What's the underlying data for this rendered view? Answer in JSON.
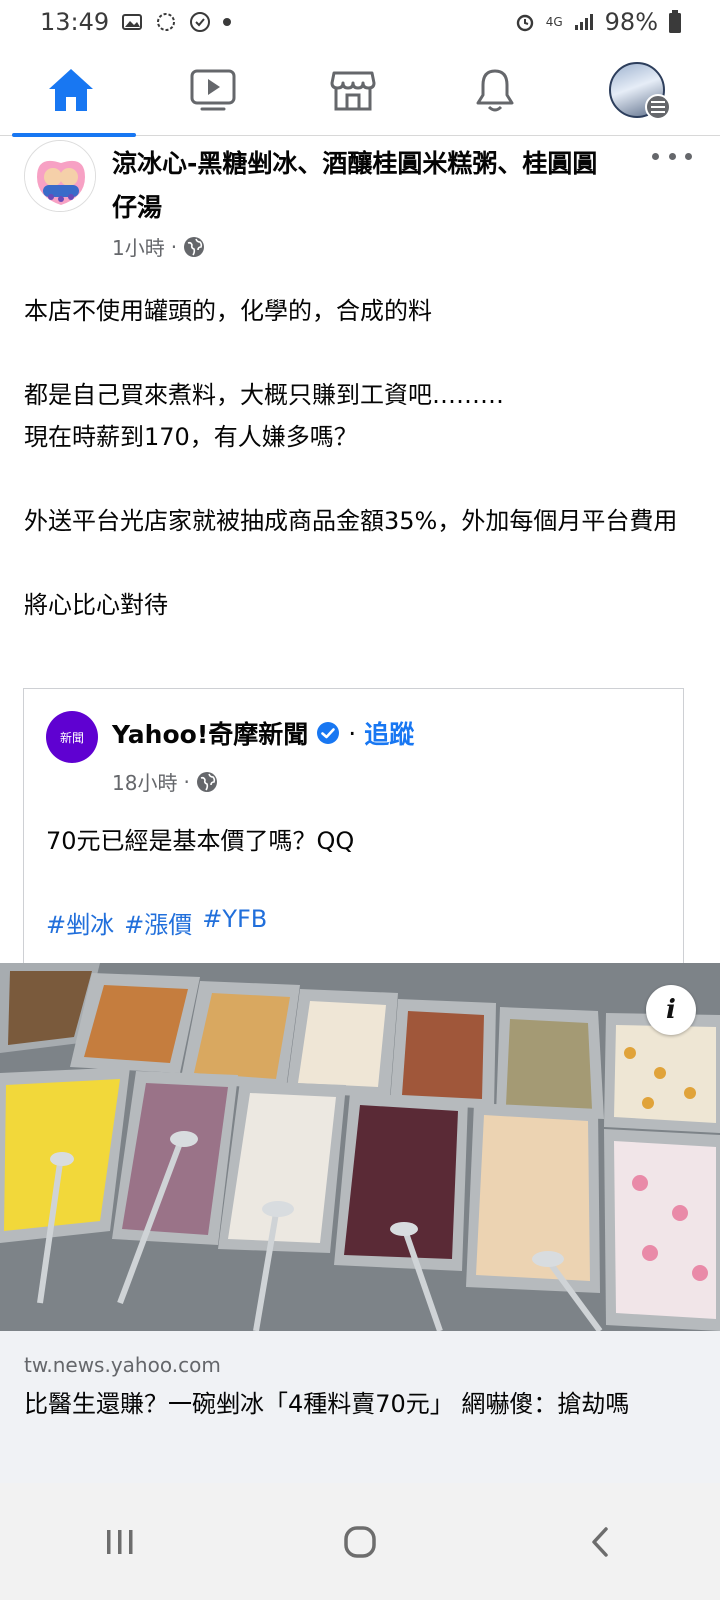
{
  "status_bar": {
    "time": "13:49",
    "network": "4G",
    "battery": "98%"
  },
  "nav": {
    "tabs": [
      {
        "name": "home",
        "icon": "home-icon",
        "active": true
      },
      {
        "name": "watch",
        "icon": "video-icon",
        "active": false
      },
      {
        "name": "marketplace",
        "icon": "marketplace-icon",
        "active": false
      },
      {
        "name": "notifications",
        "icon": "bell-icon",
        "active": false
      },
      {
        "name": "menu",
        "icon": "profile-avatar",
        "active": false
      }
    ],
    "accent_color": "#1877f2"
  },
  "post": {
    "page_name": "涼冰心-黑糖剉冰、酒釀桂圓米糕粥、桂圓圓仔湯",
    "time": "1小時",
    "separator": "·",
    "privacy_icon": "globe-icon",
    "paragraphs": [
      [
        "本店不使用罐頭的，化學的，合成的料"
      ],
      [
        "都是自己買來煮料，大概只賺到工資吧………",
        "現在時薪到170，有人嫌多嗎？"
      ],
      [
        "外送平台光店家就被抽成商品金額35%，外加每個月平台費用"
      ],
      [
        "將心比心對待"
      ]
    ]
  },
  "shared_post": {
    "source_name": "Yahoo!奇摩新聞",
    "avatar_text": "新聞",
    "verified": true,
    "separator": "·",
    "follow_label": "追蹤",
    "time": "18小時",
    "text": "70元已經是基本價了嗎？QQ",
    "hashtags": [
      "#剉冰",
      "#漲價",
      "#YFB"
    ]
  },
  "photo": {
    "info_label": "i"
  },
  "link_preview": {
    "domain": "tw.news.yahoo.com",
    "title": "比醫生還賺？一碗剉冰「4種料賣70元」 網嚇傻：搶劫嗎"
  }
}
